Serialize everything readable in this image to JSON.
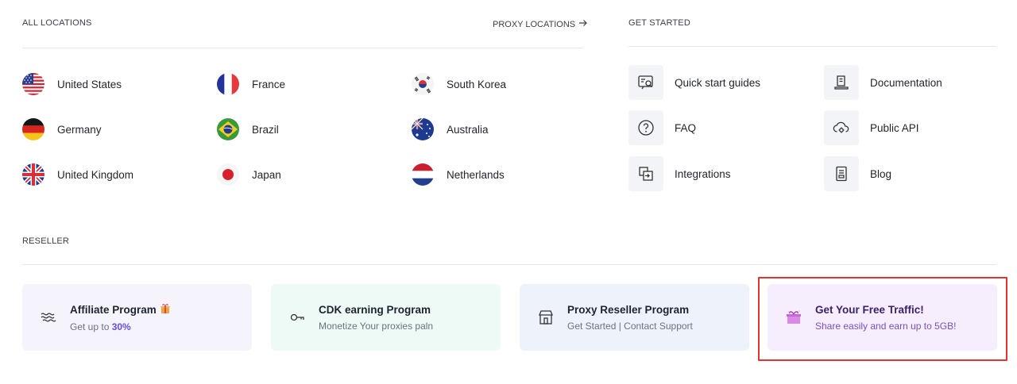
{
  "all_locations": {
    "heading": "ALL LOCATIONS",
    "proxy_link": "PROXY LOCATIONS",
    "items": [
      {
        "name": "United States",
        "flag": "us-flag-icon"
      },
      {
        "name": "France",
        "flag": "fr-flag-icon"
      },
      {
        "name": "South Korea",
        "flag": "kr-flag-icon"
      },
      {
        "name": "Germany",
        "flag": "de-flag-icon"
      },
      {
        "name": "Brazil",
        "flag": "br-flag-icon"
      },
      {
        "name": "Australia",
        "flag": "au-flag-icon"
      },
      {
        "name": "United Kingdom",
        "flag": "gb-flag-icon"
      },
      {
        "name": "Japan",
        "flag": "jp-flag-icon"
      },
      {
        "name": "Netherlands",
        "flag": "nl-flag-icon"
      }
    ]
  },
  "get_started": {
    "heading": "GET STARTED",
    "items": [
      {
        "label": "Quick start guides",
        "icon": "guide-search-icon"
      },
      {
        "label": "Documentation",
        "icon": "document-icon"
      },
      {
        "label": "FAQ",
        "icon": "question-icon"
      },
      {
        "label": "Public API",
        "icon": "cloud-gear-icon"
      },
      {
        "label": "Integrations",
        "icon": "integration-icon"
      },
      {
        "label": "Blog",
        "icon": "blog-icon"
      }
    ]
  },
  "reseller": {
    "heading": "RESELLER",
    "cards": [
      {
        "title": "Affiliate Program",
        "sub_prefix": "Get up to ",
        "sub_highlight": "30%",
        "bg": "#f5f4fc",
        "icon": "waves-icon"
      },
      {
        "title": "CDK earning Program",
        "sub": "Monetize Your proxies paln",
        "bg": "#eefaf5",
        "icon": "key-icon"
      },
      {
        "title": "Proxy Reseller Program",
        "sub": "Get Started | Contact Support",
        "bg": "#eef3fb",
        "icon": "store-icon"
      },
      {
        "title": "Get Your Free Traffic!",
        "sub": "Share easily and earn up to 5GB!",
        "bg": "#f6eefc",
        "icon": "gift-box-icon"
      }
    ]
  },
  "colors": {
    "accent": "#6b4ae6",
    "highlight_border": "#e8322e",
    "free_traffic_title": "#3b1f6e",
    "free_traffic_sub": "#7a4fc4"
  }
}
